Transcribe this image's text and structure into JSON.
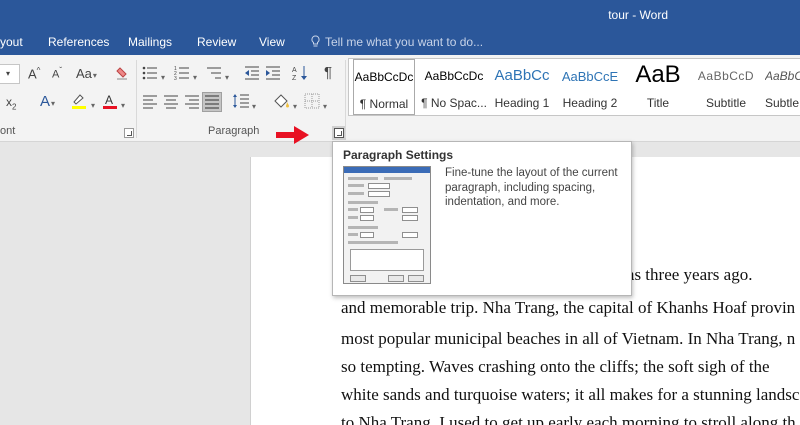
{
  "window": {
    "title": "tour - Word"
  },
  "tabs": [
    "yout",
    "References",
    "Mailings",
    "Review",
    "View"
  ],
  "tell_me": {
    "placeholder": "Tell me what you want to do..."
  },
  "ribbon": {
    "font_group_label": "ont",
    "paragraph_group_label": "Paragraph",
    "font_size_value": "",
    "styles": [
      {
        "sample": "AaBbCcDc",
        "name": "¶ Normal",
        "selected": true
      },
      {
        "sample": "AaBbCcDc",
        "name": "¶ No Spac..."
      },
      {
        "sample": "AaBbCc",
        "name": "Heading 1"
      },
      {
        "sample": "AaBbCcE",
        "name": "Heading 2"
      },
      {
        "sample": "AaB",
        "name": "Title"
      },
      {
        "sample": "AaBbCcD",
        "name": "Subtitle"
      },
      {
        "sample": "AaBbCcL",
        "name": "Subtle E"
      }
    ]
  },
  "tooltip": {
    "title": "Paragraph Settings",
    "description": "Fine-tune the layout of the current paragraph, including spacing, indentation, and more."
  },
  "document": {
    "lines": [
      "ty, was three years ago.",
      "and memorable trip. Nha Trang, the capital of Khanhs Hoaf provin",
      "most popular municipal beaches in all of Vietnam. In Nha Trang, n",
      "so tempting. Waves crashing onto the cliffs; the soft sigh of the",
      "white sands and turquoise waters; it all makes for a stunning landsc",
      "to Nha Trang. I used to get up early each morning to stroll along th"
    ]
  },
  "colors": {
    "brand": "#2b579a",
    "highlight": "#ffff00",
    "font_color": "#e81123",
    "arrow": "#e81123"
  },
  "icons": [
    "lightbulb-icon",
    "grow-font-icon",
    "shrink-font-icon",
    "change-case-icon",
    "clear-formatting-icon",
    "bullets-icon",
    "numbering-icon",
    "multilevel-list-icon",
    "decrease-indent-icon",
    "increase-indent-icon",
    "sort-icon",
    "show-marks-icon",
    "align-left-icon",
    "center-icon",
    "align-right-icon",
    "justify-icon",
    "line-spacing-icon",
    "shading-icon",
    "borders-icon",
    "text-effects-icon",
    "highlight-icon",
    "font-color-icon",
    "subscript-icon",
    "dialog-launcher-icon",
    "red-arrow-icon"
  ]
}
